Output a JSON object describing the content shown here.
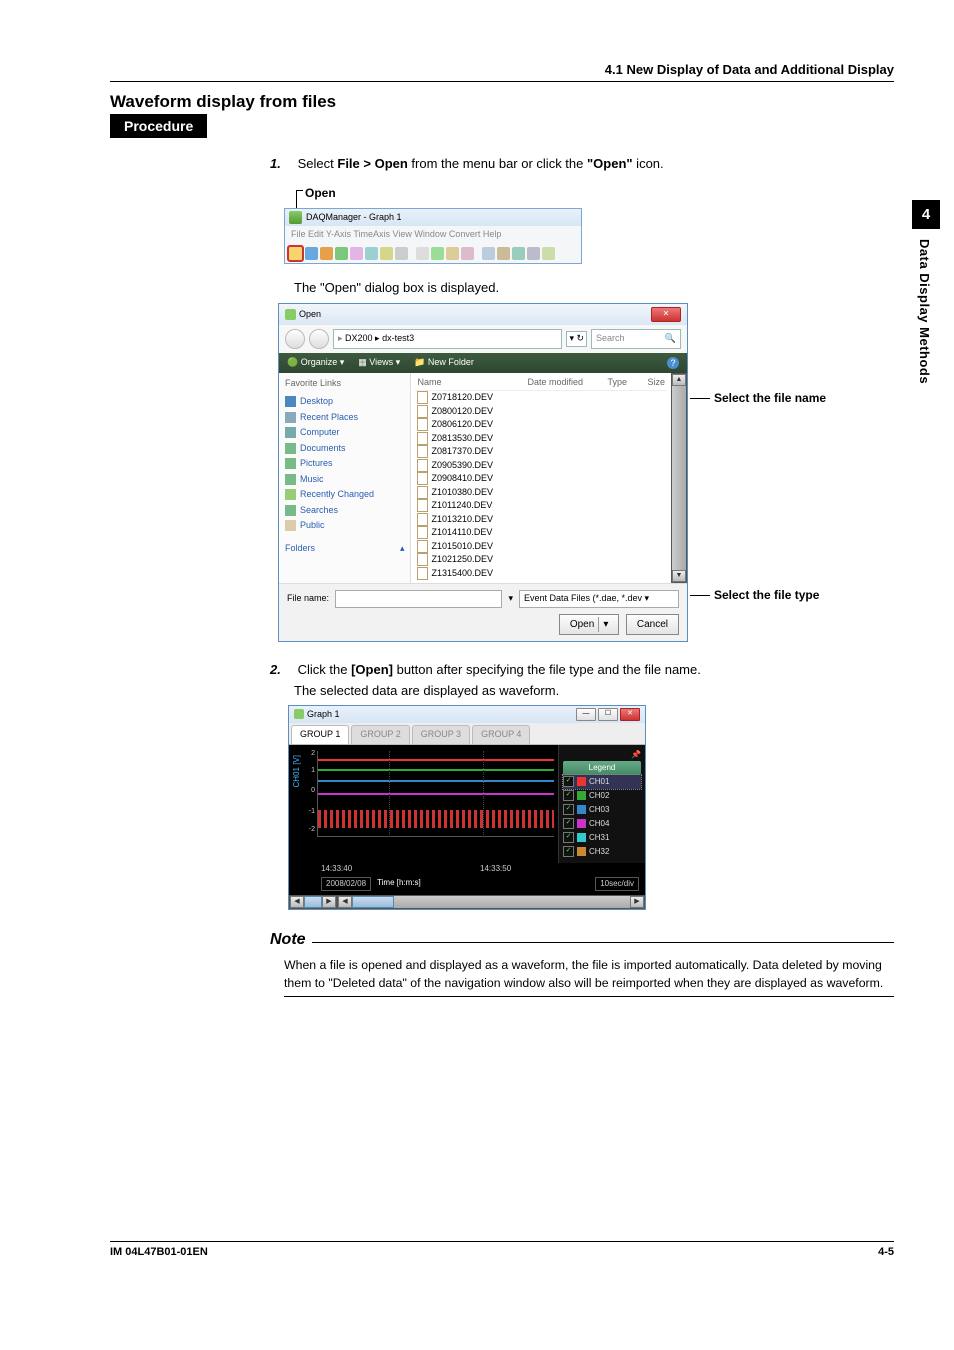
{
  "header": {
    "section": "4.1  New Display of Data and Additional Display"
  },
  "title": "Waveform display from files",
  "procedure_label": "Procedure",
  "step1": {
    "num": "1.",
    "text_pre": "Select ",
    "bold1": "File > Open",
    "text_mid": " from the menu bar or click the ",
    "bold2": "\"Open\"",
    "text_end": " icon."
  },
  "open_callout": "Open",
  "mini": {
    "title": "DAQManager - Graph 1",
    "menu": "File   Edit   Y-Axis   TimeAxis   View   Window   Convert   Help"
  },
  "step1_after": "The \"Open\" dialog box is displayed.",
  "dialog": {
    "title": "Open",
    "path": "DX200  ▸  dx-test3",
    "search": "Search",
    "toolbar": {
      "org": "Organize ▾",
      "views": "Views ▾",
      "newf": "New Folder"
    },
    "fav_head": "Favorite Links",
    "fav": [
      "Desktop",
      "Recent Places",
      "Computer",
      "Documents",
      "Pictures",
      "Music",
      "Recently Changed",
      "Searches",
      "Public"
    ],
    "folders": "Folders",
    "cols": {
      "name": "Name",
      "date": "Date modified",
      "type": "Type",
      "size": "Size"
    },
    "files": [
      "Z0718120.DEV",
      "Z0800120.DEV",
      "Z0806120.DEV",
      "Z0813530.DEV",
      "Z0817370.DEV",
      "Z0905390.DEV",
      "Z0908410.DEV",
      "Z1010380.DEV",
      "Z1011240.DEV",
      "Z1013210.DEV",
      "Z1014110.DEV",
      "Z1015010.DEV",
      "Z1021250.DEV",
      "Z1315400.DEV"
    ],
    "fn_label": "File name:",
    "ftype": "Event Data Files (*.dae, *.dev ▾",
    "open_btn": "Open",
    "cancel_btn": "Cancel"
  },
  "callout_filename": "Select the file name",
  "callout_filetype": "Select the file type",
  "step2": {
    "num": "2.",
    "pre": "Click the ",
    "bold": "[Open]",
    "post": " button after specifying the file type and the file name.",
    "line2": "The selected data are displayed as waveform."
  },
  "graph": {
    "title": "Graph 1",
    "tabs": [
      "GROUP 1",
      "GROUP 2",
      "GROUP 3",
      "GROUP 4"
    ],
    "ylabel": "CH01 [V]",
    "yticks": [
      "2",
      "1",
      "0",
      "-1",
      "-2"
    ],
    "xticks": [
      "14:33:40",
      "14:33:50"
    ],
    "xaxis": "Time [h:m:s]",
    "date": "2008/02/08",
    "divbox": "10sec/div",
    "legend_head": "Legend",
    "legend": [
      {
        "name": "CH01",
        "color": "#e33"
      },
      {
        "name": "CH02",
        "color": "#3a3"
      },
      {
        "name": "CH03",
        "color": "#38c"
      },
      {
        "name": "CH04",
        "color": "#c3c"
      },
      {
        "name": "CH31",
        "color": "#3cc"
      },
      {
        "name": "CH32",
        "color": "#c83"
      }
    ]
  },
  "note_head": "Note",
  "note_body": "When a file is opened and displayed as a waveform, the file is imported automatically. Data deleted by moving them to \"Deleted data\" of the navigation window also will be reimported when they are displayed as waveform.",
  "side": {
    "num": "4",
    "label": "Data Display Methods"
  },
  "footer": {
    "left": "IM 04L47B01-01EN",
    "right": "4-5"
  }
}
